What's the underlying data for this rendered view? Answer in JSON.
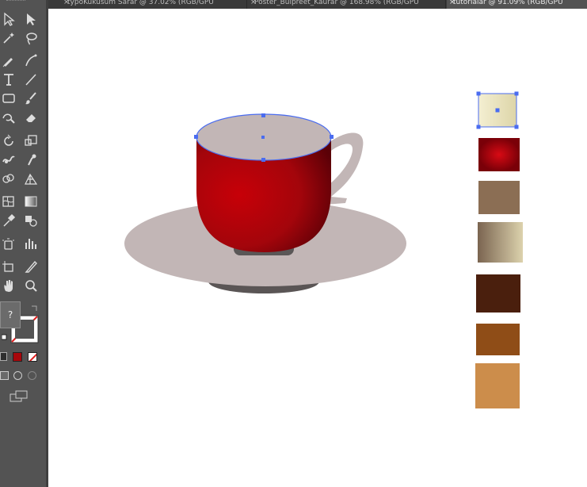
{
  "tabs": [
    {
      "label": "typoKukusum Sarar @ 37.02% (RGB/GPU",
      "active": false
    },
    {
      "label": "Poster_Bulpreet_Kaurar @ 168.98% (RGB/GPU",
      "active": false
    },
    {
      "label": "tutorialar @ 91.09% (RGB/GPU",
      "active": true
    }
  ],
  "tooltip": {
    "text": "?"
  },
  "toolbar": {
    "icons": [
      "selection-icon",
      "direct-selection-icon",
      "magic-wand-icon",
      "lasso-icon",
      "pen-icon",
      "curvature-icon",
      "type-icon",
      "line-segment-icon",
      "rectangle-icon",
      "paintbrush-icon",
      "shaper-icon",
      "eraser-icon",
      "rotate-icon",
      "scale-icon",
      "warp-icon",
      "puppet-warp-icon",
      "shape-builder-icon",
      "perspective-grid-icon",
      "mesh-icon",
      "gradient-icon",
      "eyedropper-icon",
      "blend-icon",
      "symbol-sprayer-icon",
      "column-graph-icon",
      "artboard-icon",
      "slice-icon",
      "hand-icon",
      "zoom-icon"
    ],
    "fill_color": "#ffffff",
    "stroke_color": "none",
    "color_mode_icons": [
      "color-mode-icon",
      "gradient-mode-icon",
      "none-mode-icon"
    ],
    "draw_mode_icons": [
      "draw-normal-icon",
      "draw-behind-icon",
      "draw-inside-icon"
    ],
    "screen_mode_icon": "screen-mode-icon"
  },
  "artwork": {
    "cup_color": "#a8070b",
    "saucer_color": "#c2b6b6",
    "selection_color": "#4a6cf0"
  },
  "swatches": [
    {
      "name": "cream-gradient",
      "colors": [
        "#f4efd2",
        "#ddd5a8"
      ],
      "selected": true
    },
    {
      "name": "red-radial",
      "colors": [
        "#d80a14",
        "#7a0008"
      ],
      "selected": false
    },
    {
      "name": "brown-taupe",
      "colors": [
        "#8b6e54"
      ],
      "selected": false
    },
    {
      "name": "beige-gradient",
      "colors": [
        "#7a6450",
        "#dcd2ad"
      ],
      "selected": false
    },
    {
      "name": "dark-brown",
      "colors": [
        "#4a1f0d"
      ],
      "selected": false
    },
    {
      "name": "rust-brown",
      "colors": [
        "#8f4d17"
      ],
      "selected": false
    },
    {
      "name": "caramel",
      "colors": [
        "#cc8d4b"
      ],
      "selected": false
    }
  ]
}
